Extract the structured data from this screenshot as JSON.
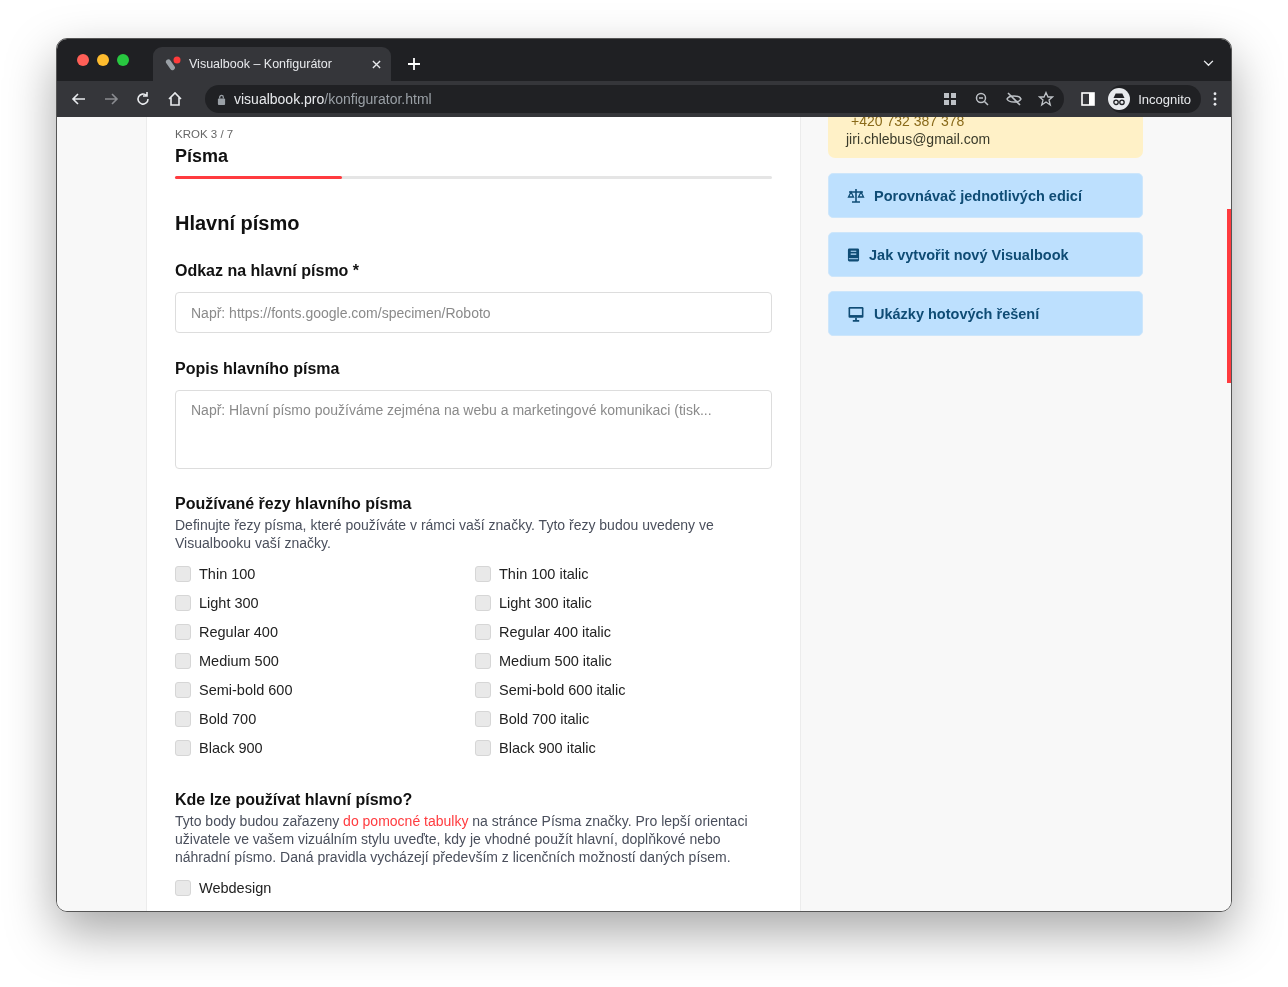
{
  "browser": {
    "tab_title": "Visualbook – Konfigurátor",
    "url_host": "visualbook.pro",
    "url_path": "/konfigurator.html",
    "profile_label": "Incognito"
  },
  "main": {
    "step": "KROK 3 / 7",
    "title": "Písma",
    "progress": {
      "level": 0.28
    },
    "section_title": "Hlavní písmo",
    "fields": [
      {
        "kind": "input",
        "label": "Odkaz na hlavní písmo *",
        "placeholder": "Např: https://fonts.google.com/specimen/Roboto"
      },
      {
        "kind": "textarea",
        "label": "Popis hlavního písma",
        "placeholder": "Např: Hlavní písmo používáme zejména na webu a marketingové komunikaci (tisk..."
      }
    ],
    "weights": {
      "title": "Používané řezy hlavního písma",
      "description": "Definujte řezy písma, které používáte v rámci vaší značky. Tyto řezy budou uvedeny ve Visualbooku vaší značky.",
      "options": [
        {
          "label": "Thin 100",
          "checked": false
        },
        {
          "label": "Thin 100 italic",
          "checked": false
        },
        {
          "label": "Light 300",
          "checked": false
        },
        {
          "label": "Light 300 italic",
          "checked": false
        },
        {
          "label": "Regular 400",
          "checked": false
        },
        {
          "label": "Regular 400 italic",
          "checked": false
        },
        {
          "label": "Medium 500",
          "checked": false
        },
        {
          "label": "Medium 500 italic",
          "checked": false
        },
        {
          "label": "Semi-bold 600",
          "checked": false
        },
        {
          "label": "Semi-bold 600 italic",
          "checked": false
        },
        {
          "label": "Bold 700",
          "checked": false
        },
        {
          "label": "Bold 700 italic",
          "checked": false
        },
        {
          "label": "Black 900",
          "checked": false
        },
        {
          "label": "Black 900 italic",
          "checked": false
        }
      ]
    },
    "usage": {
      "title": "Kde lze používat hlavní písmo?",
      "description_before": "Tyto body budou zařazeny",
      "link": "do pomocné tabulky",
      "description_after": "na stránce Písma značky. Pro lepší orientaci uživatele ve vašem vizuálním stylu uveďte, kdy je vhodné použít hlavní, doplňkové nebo náhradní písmo. Daná pravidla vycházejí především z licenčních možností daných písem.",
      "options": [
        {
          "label": "Webdesign",
          "checked": false
        }
      ]
    }
  },
  "sidebar": {
    "contact": {
      "phone": "+420 732 387 378",
      "email": "jiri.chlebus@gmail.com"
    },
    "links": [
      {
        "kind": "scale",
        "label": "Porovnávač jednotlivých edicí"
      },
      {
        "kind": "book",
        "label": "Jak vytvořit nový Visualbook"
      },
      {
        "kind": "monitor",
        "label": "Ukázky hotových řešení"
      }
    ]
  }
}
